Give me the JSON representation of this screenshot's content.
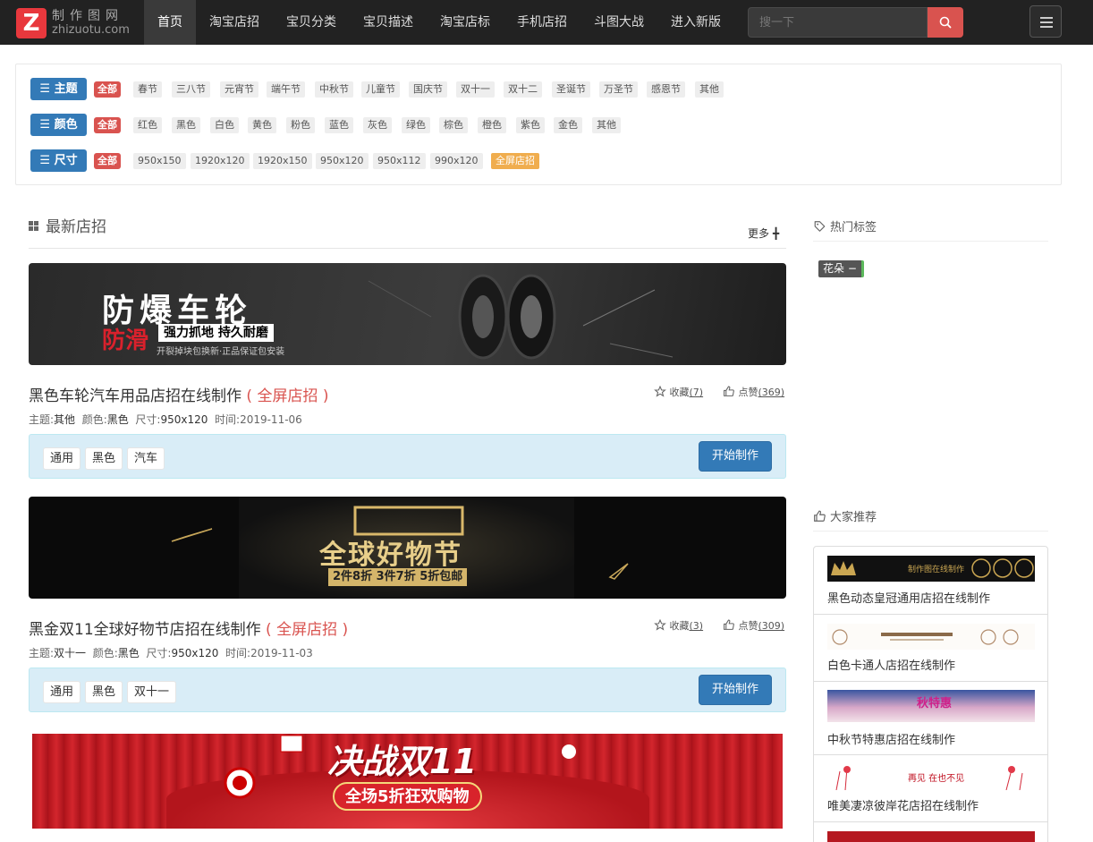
{
  "header": {
    "logo_letter": "Z",
    "logo_cn": "制作图网",
    "logo_en": "zhizuotu.com",
    "nav": [
      "首页",
      "淘宝店招",
      "宝贝分类",
      "宝贝描述",
      "淘宝店标",
      "手机店招",
      "斗图大战",
      "进入新版"
    ],
    "search_placeholder": "搜一下"
  },
  "filters": {
    "all_label": "全部",
    "rows": [
      {
        "label": "☰ 主题",
        "tags": [
          "春节",
          "三八节",
          "元宵节",
          "端午节",
          "中秋节",
          "儿童节",
          "国庆节",
          "双十一",
          "双十二",
          "圣诞节",
          "万圣节",
          "感恩节",
          "其他"
        ]
      },
      {
        "label": "☰ 颜色",
        "tags": [
          "红色",
          "黑色",
          "白色",
          "黄色",
          "粉色",
          "蓝色",
          "灰色",
          "绿色",
          "棕色",
          "橙色",
          "紫色",
          "金色",
          "其他"
        ]
      },
      {
        "label": "☰ 尺寸",
        "tags": [
          "950x150",
          "1920x120",
          "1920x150",
          "950x120",
          "950x112",
          "990x120",
          "全屏店招"
        ]
      }
    ]
  },
  "main": {
    "section_title": "最新店招",
    "more_label": "更多 ╋",
    "start_label": "开始制作",
    "items": [
      {
        "title": "黑色车轮汽车用品店招在线制作",
        "fullscreen": "( 全屏店招 )",
        "meta": {
          "theme_label": "主题:",
          "theme": "其他",
          "color_label": "颜色:",
          "color": "黑色",
          "size_label": "尺寸:",
          "size": "950x120",
          "time_label": "时间:",
          "time": "2019-11-06"
        },
        "fav_label": "收藏",
        "fav_count": "(7)",
        "like_label": "点赞",
        "like_count": "(369)",
        "tags": [
          "通用",
          "黑色",
          "汽车"
        ],
        "banner": {
          "title": "防爆车轮",
          "sub_red": "防滑",
          "slogan": "强力抓地 持久耐磨",
          "small": "开裂掉块包换新·正品保证包安装"
        }
      },
      {
        "title": "黑金双11全球好物节店招在线制作",
        "fullscreen": "( 全屏店招 )",
        "meta": {
          "theme_label": "主题:",
          "theme": "双十一",
          "color_label": "颜色:",
          "color": "黑色",
          "size_label": "尺寸:",
          "size": "950x120",
          "time_label": "时间:",
          "time": "2019-11-03"
        },
        "fav_label": "收藏",
        "fav_count": "(3)",
        "like_label": "点赞",
        "like_count": "(309)",
        "tags": [
          "通用",
          "黑色",
          "双十一"
        ],
        "banner": {
          "title": "全球好物节",
          "offer": "2件8折 3件7折 5折包邮"
        }
      },
      {
        "banner": {
          "title": "决战双11",
          "offer": "全场5折狂欢购物"
        }
      }
    ]
  },
  "sidebar": {
    "hot_title": "热门标签",
    "hot_tag": "花朵 −",
    "rec_title": "大家推荐",
    "rec_items": [
      "黑色动态皇冠通用店招在线制作",
      "白色卡通人店招在线制作",
      "中秋节特惠店招在线制作",
      "唯美凄凉彼岸花店招在线制作"
    ],
    "rec_thumb_texts": [
      "制作图在线制作",
      "",
      "秋特惠",
      "再见 在也不见"
    ]
  },
  "colors": {
    "accent_blue": "#337ab7",
    "accent_red": "#d9534f",
    "accent_orange": "#f0ad4e",
    "nav_bg": "#222222"
  }
}
